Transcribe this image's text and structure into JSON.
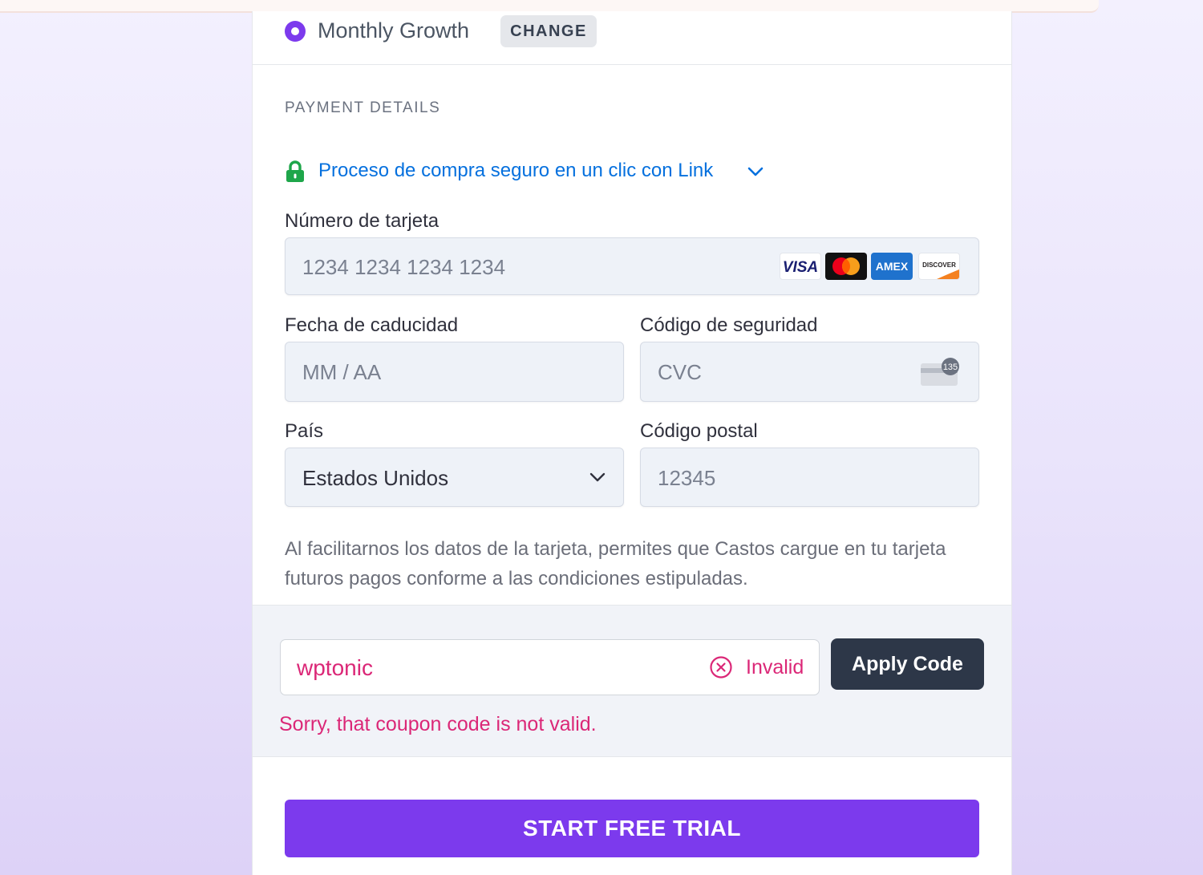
{
  "plan": {
    "name": "Monthly Growth",
    "change_label": "CHANGE"
  },
  "payment": {
    "section_title": "PAYMENT DETAILS",
    "link_text": "Proceso de compra seguro en un clic con Link",
    "card_number": {
      "label": "Número de tarjeta",
      "placeholder": "1234 1234 1234 1234",
      "brands": [
        "VISA",
        "mastercard",
        "AMEX",
        "DISCOVER"
      ]
    },
    "expiry": {
      "label": "Fecha de caducidad",
      "placeholder": "MM / AA"
    },
    "cvc": {
      "label": "Código de seguridad",
      "placeholder": "CVC",
      "icon_badge": "135"
    },
    "country": {
      "label": "País",
      "value": "Estados Unidos"
    },
    "postal": {
      "label": "Código postal",
      "placeholder": "12345"
    },
    "consent_text": "Al facilitarnos los datos de la tarjeta, permites que Castos cargue en tu tarjeta futuros pagos conforme a las condiciones estipuladas."
  },
  "coupon": {
    "value": "wptonic",
    "status": "Invalid",
    "apply_label": "Apply Code",
    "error": "Sorry, that coupon code is not valid."
  },
  "cta": {
    "label": "START FREE TRIAL"
  },
  "colors": {
    "accent": "#7c3aed",
    "link": "#0570de",
    "error": "#db2777",
    "lock": "#1ea64a",
    "dark_button": "#2d3748"
  }
}
